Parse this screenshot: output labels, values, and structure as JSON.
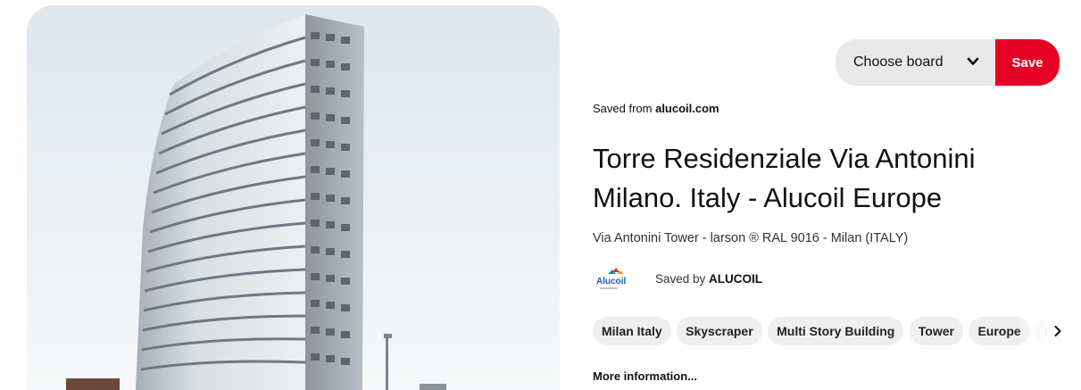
{
  "pin": {
    "image_alt": "Torre Residenziale Via Antonini",
    "saved_from_prefix": "Saved from ",
    "saved_from_domain": "alucoil.com",
    "title": "Torre Residenziale Via Antonini Milano. Italy - Alucoil Europe",
    "description": "Via Antonini Tower - larson ® RAL 9016 - Milan (ITALY)",
    "saved_by_prefix": "Saved by ",
    "saved_by_user": "ALUCOIL",
    "logo_text": "Alucoil",
    "more_info": "More information..."
  },
  "actions": {
    "board_placeholder": "Choose board",
    "save_label": "Save"
  },
  "tags": [
    "Milan Italy",
    "Skyscraper",
    "Multi Story Building",
    "Tower",
    "Europe",
    "It"
  ],
  "colors": {
    "accent": "#e60023",
    "board_bg": "#e9e9e9",
    "tag_bg": "#efefef"
  },
  "icons": {
    "board_dropdown": "chevron-down-icon",
    "tags_scroll": "chevron-right-icon"
  }
}
